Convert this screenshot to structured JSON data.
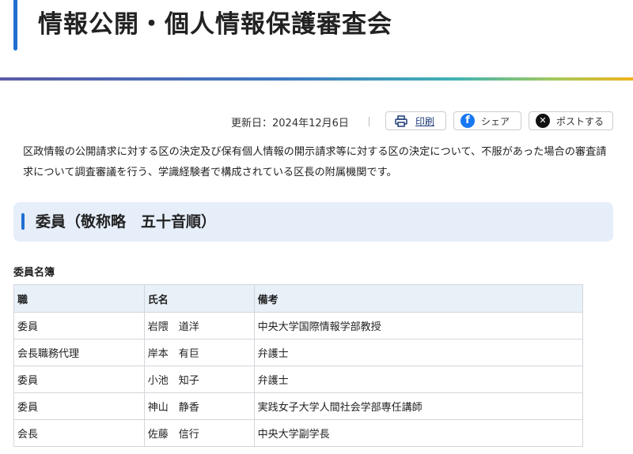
{
  "page": {
    "title": "情報公開・個人情報保護審査会"
  },
  "meta": {
    "updated": "更新日：2024年12月6日",
    "print_label": "印刷",
    "share_label": "シェア",
    "post_label": "ポストする"
  },
  "intro": "区政情報の公開請求に対する区の決定及び保有個人情報の開示請求等に対する区の決定について、不服があった場合の審査請求について調査審議を行う、学識経験者で構成されている区長の附属機関です。",
  "section": {
    "heading": "委員（敬称略　五十音順）"
  },
  "table": {
    "caption": "委員名簿",
    "headers": [
      "職",
      "氏名",
      "備考"
    ],
    "rows": [
      [
        "委員",
        "岩隈　道洋",
        "中央大学国際情報学部教授"
      ],
      [
        "会長職務代理",
        "岸本　有巨",
        "弁護士"
      ],
      [
        "委員",
        "小池　知子",
        "弁護士"
      ],
      [
        "委員",
        "神山　静香",
        "実践女子大学人間社会学部専任講師"
      ],
      [
        "会長",
        "佐藤　信行",
        "中央大学副学長"
      ]
    ]
  },
  "colors": {
    "accent": "#1f6fd1",
    "section_bg": "#e6eefa",
    "table_header_bg": "#e8f0f8"
  }
}
